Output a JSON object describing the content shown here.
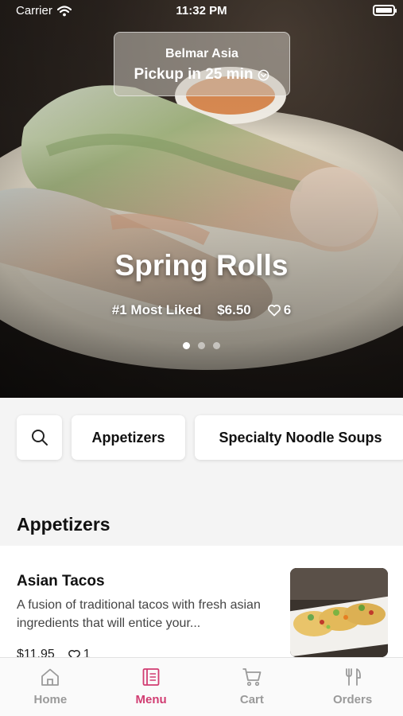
{
  "status_bar": {
    "carrier": "Carrier",
    "time": "11:32 PM"
  },
  "pickup": {
    "store": "Belmar Asia",
    "label": "Pickup in 25 min"
  },
  "hero": {
    "title": "Spring Rolls",
    "rank": "#1 Most Liked",
    "price": "$6.50",
    "likes": "6",
    "slide_index": 1,
    "slide_count": 3
  },
  "categories": {
    "chip_1": "Appetizers",
    "chip_2": "Specialty Noodle Soups"
  },
  "section": {
    "title": "Appetizers"
  },
  "item": {
    "name": "Asian Tacos",
    "description": "A fusion of traditional tacos with fresh asian ingredients that will entice your...",
    "price": "$11.95",
    "likes": "1"
  },
  "tabs": {
    "home": "Home",
    "menu": "Menu",
    "cart": "Cart",
    "orders": "Orders",
    "active": "menu"
  },
  "colors": {
    "accent": "#d13d72",
    "inactive": "#9a9a9a"
  },
  "icons": [
    "wifi-icon",
    "battery-icon",
    "chevron-circle-down-icon",
    "heart-icon",
    "search-icon",
    "home-icon",
    "menu-book-icon",
    "cart-icon",
    "utensils-icon"
  ]
}
